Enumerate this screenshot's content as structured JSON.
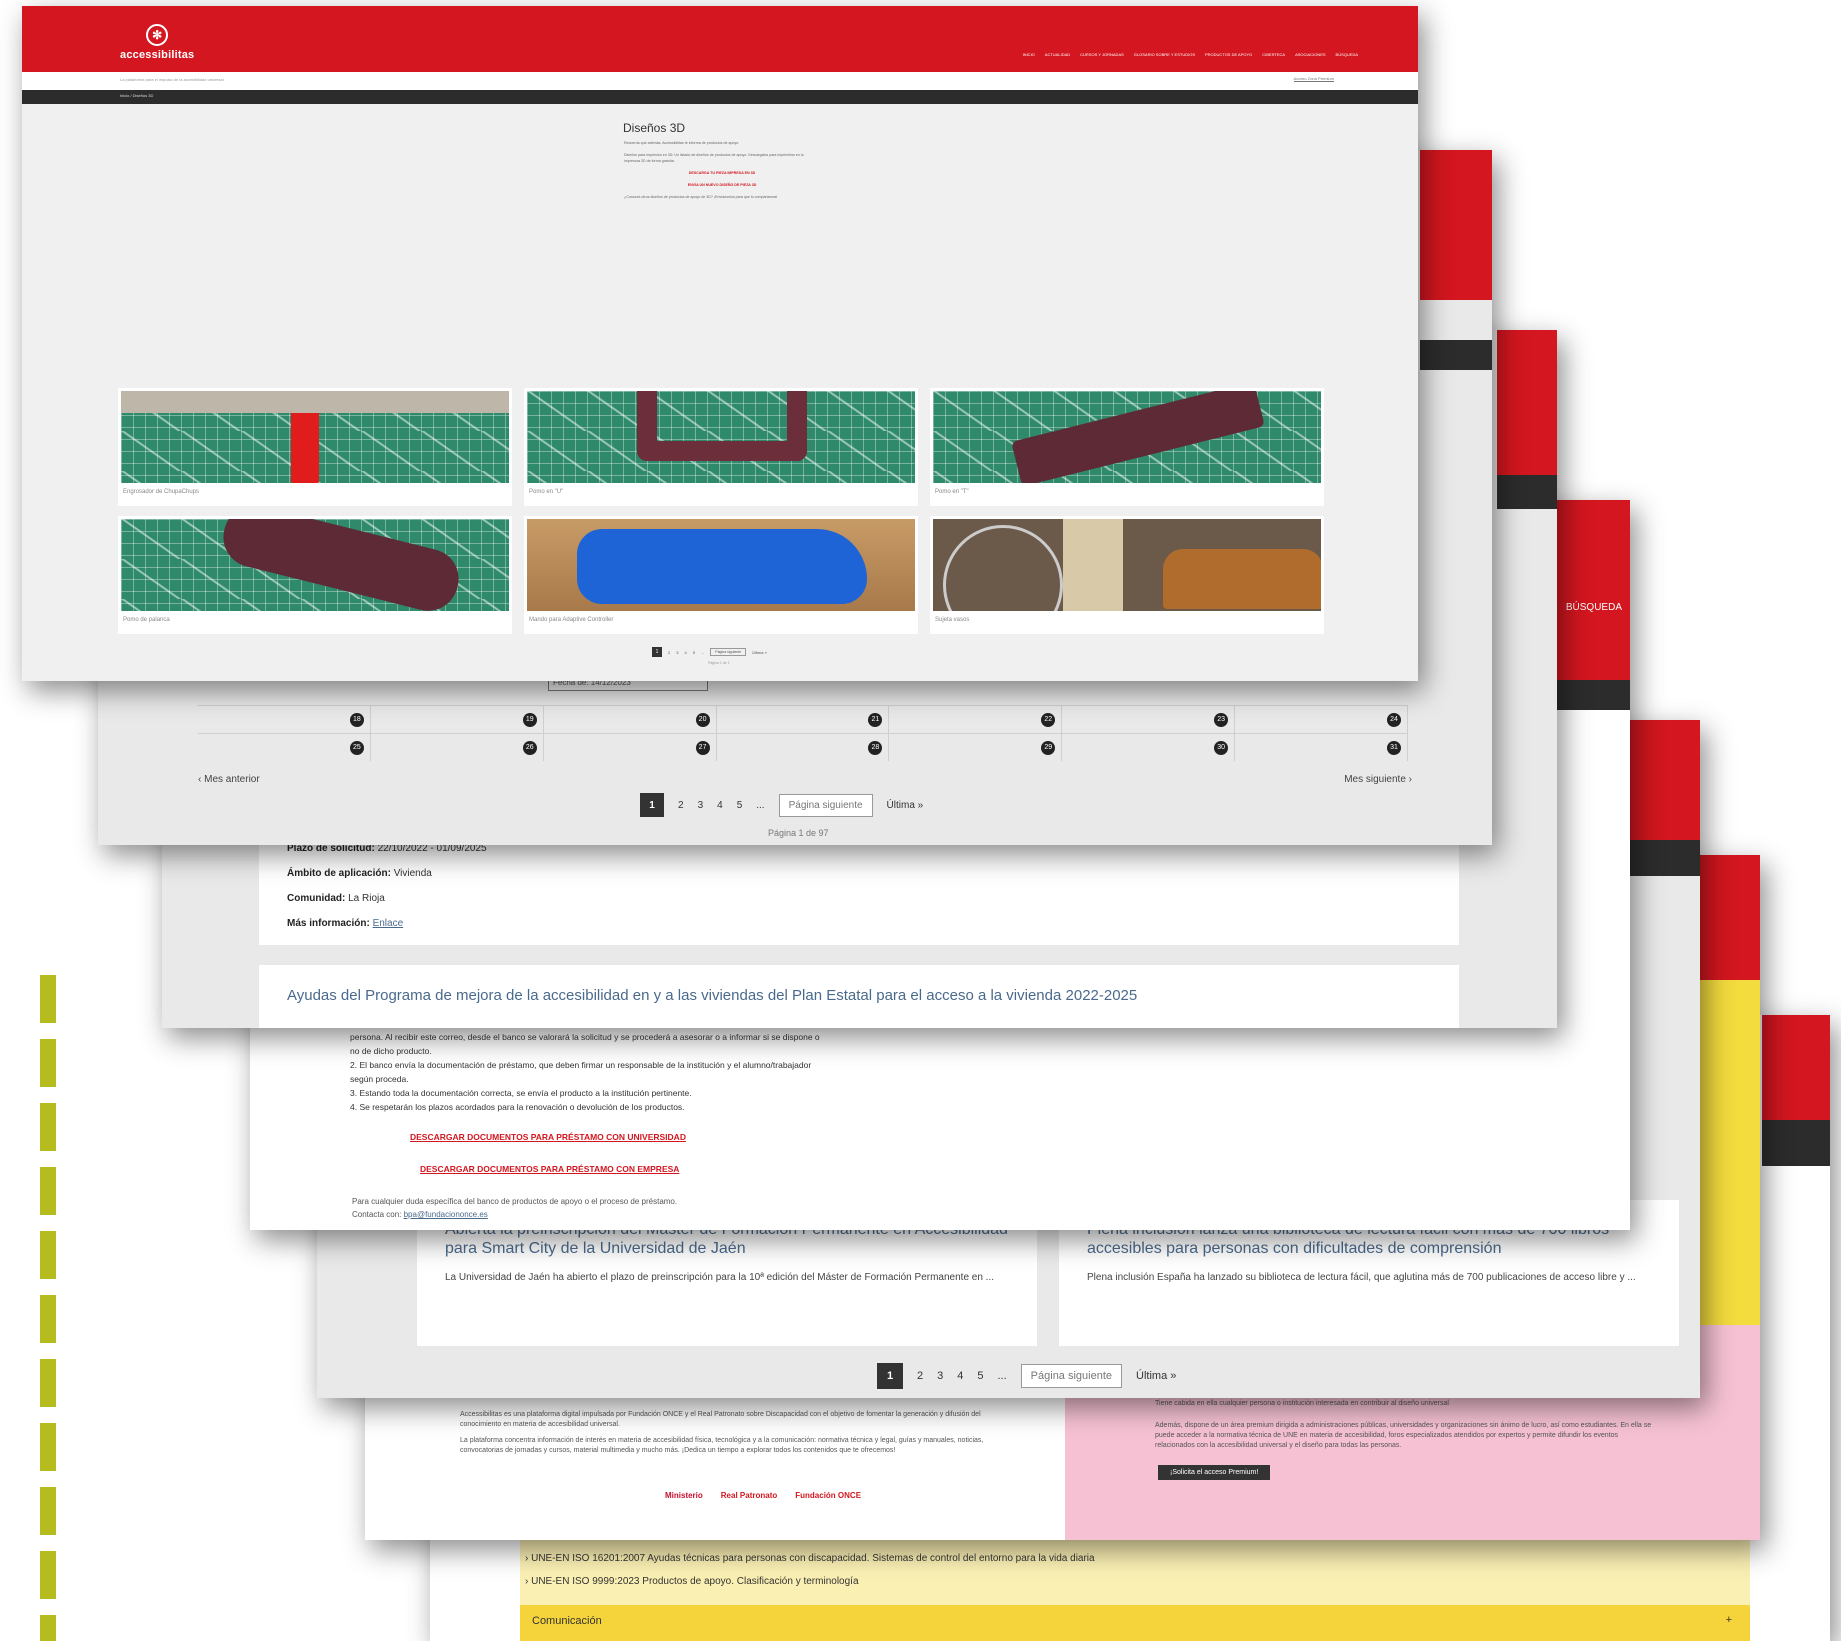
{
  "sheet1": {
    "logo": "accessibilitas",
    "nav": [
      "Inicio",
      "Actualidad",
      "Cursos y jornadas",
      "Glosario sobre y estudios",
      "Productos de apoyo",
      "Ciberteca",
      "Asociaciones",
      "Búsqueda"
    ],
    "subheader_text": "La plataforma para el impulso de la accesibilidad universal",
    "account_link": "Acceso Zona Premium",
    "breadcrumb": "Inicio / Diseños 3D",
    "title": "Diseños 3D",
    "intro_lines": [
      "Recuerda que además, Accessibilitas te informa de productos de apoyo.",
      "Diseños para impresión en 3D: Un listado de diseños de productos de apoyo. Descárgalos para imprimirlos en tu impresora 3D de forma gratuita.",
      "¿Conoces otros diseños de productos de apoyo de 3D? ¡Envíanoslos para que lo compartamos!"
    ],
    "red_link_1": "DESCARGA TU PIEZA IMPRESA EN 3D",
    "red_link_2": "ENVÍA UN NUEVO DISEÑO DE PIEZA 3D",
    "products": [
      {
        "caption": "Engrosador de ChupaChups"
      },
      {
        "caption": "Pomo en \"U\""
      },
      {
        "caption": "Pomo en \"T\""
      },
      {
        "caption": "Pomo de palanca"
      },
      {
        "caption": "Mando para Adaptive Controller"
      },
      {
        "caption": "Sujeta vasos"
      }
    ],
    "pagination": {
      "pages": [
        "1",
        "2",
        "3",
        "4",
        "5",
        "..."
      ],
      "next": "Página siguiente",
      "last": "Última »",
      "info": "Página 1 de 1"
    }
  },
  "sheet2": {
    "date_field": "Fecha de: 14/12/2023",
    "calendar_rows": [
      [
        "18",
        "19",
        "20",
        "21",
        "22",
        "23",
        "24"
      ],
      [
        "25",
        "26",
        "27",
        "28",
        "29",
        "30",
        "31"
      ]
    ],
    "prev_month": "‹ Mes anterior",
    "next_month": "Mes siguiente ›",
    "pagination": {
      "pages": [
        "1",
        "2",
        "3",
        "4",
        "5",
        "..."
      ],
      "next": "Página siguiente",
      "last": "Última »",
      "info": "Página 1 de 97"
    }
  },
  "sheet3": {
    "fields": [
      {
        "label": "Plazo de solicitud:",
        "value": "22/10/2022 - 01/09/2025"
      },
      {
        "label": "Ámbito de aplicación:",
        "value": "Vivienda"
      },
      {
        "label": "Comunidad:",
        "value": "La Rioja"
      },
      {
        "label": "Más información:",
        "value": "Enlace"
      }
    ],
    "card_title": "Ayudas del Programa de mejora de la accesibilidad en y a las viviendas del Plan Estatal para el acceso a la vivienda 2022-2025"
  },
  "sheet4": {
    "search_label": "BÚSQUEDA",
    "step_lead": "persona. Al recibir este correo, desde el banco se valorará la solicitud y se procederá a asesorar o a informar si se dispone o no de dicho producto.",
    "steps": [
      "2. El banco envía la documentación de préstamo, que deben firmar un responsable de la institución y el alumno/trabajador según proceda.",
      "3. Estando toda la documentación correcta, se envía el producto a la institución pertinente.",
      "4. Se respetarán los plazos acordados para la renovación o devolución de los productos."
    ],
    "download_1": "DESCARGAR DOCUMENTOS PARA PRÉSTAMO CON UNIVERSIDAD",
    "download_2": "DESCARGAR DOCUMENTOS PARA PRÉSTAMO CON EMPRESA",
    "contact_line": "Para cualquier duda específica del banco de productos de apoyo o el proceso de préstamo.",
    "contact_label": "Contacta con:",
    "contact_email": "bpa@fundaciononce.es"
  },
  "sheet5": {
    "cards": [
      {
        "title": "Abierta la preinscripción del Máster de Formación Permanente en Accesibilidad para Smart City de la Universidad de Jaén",
        "excerpt": "La Universidad de Jaén ha abierto el plazo de preinscripción para la 10ª edición del Máster de Formación Permanente en ..."
      },
      {
        "title": "Plena inclusión lanza una biblioteca de lectura fácil con más de 700 libros accesibles para personas con dificultades de comprensión",
        "excerpt": "Plena inclusión España ha lanzado su biblioteca de lectura fácil, que aglutina más de 700 publicaciones de acceso libre y ..."
      }
    ],
    "pagination": {
      "pages": [
        "1",
        "2",
        "3",
        "4",
        "5",
        "..."
      ],
      "next": "Página siguiente",
      "last": "Última »"
    }
  },
  "sheet6": {
    "about_1": "Accessibilitas es una plataforma digital impulsada por Fundación ONCE y el Real Patronato sobre Discapacidad con el objetivo de fomentar la generación y difusión del conocimiento en materia de accesibilidad universal.",
    "about_2": "La plataforma concentra información de interés en materia de accesibilidad física, tecnológica y a la comunicación: normativa técnica y legal, guías y manuales, noticias, convocatorias de jornadas y cursos, material multimedia y mucho más. ¡Dedica un tiempo a explorar todos los contenidos que te ofrecemos!",
    "logos": [
      "Ministerio",
      "Real Patronato",
      "Fundación ONCE"
    ],
    "premium_title": "Tiene cabida en ella cualquier persona o institución interesada en contribuir al diseño universal",
    "premium_text": "Además, dispone de un área premium dirigida a administraciones públicas, universidades y organizaciones sin ánimo de lucro, así como estudiantes. En ella se puede acceder a la normativa técnica de UNE en materia de accesibilidad, foros especializados atendidos por expertos y permite difundir los eventos relacionados con la accesibilidad universal y el diseño para todas las personas.",
    "premium_button": "¡Solicita el acceso Premium!"
  },
  "sheet7": {
    "norms": [
      "› UNE-EN ISO 16201:2007 Ayudas técnicas para personas con discapacidad. Sistemas de control del entorno para la vida diaria",
      "› UNE-EN ISO 9999:2023 Productos de apoyo. Clasificación y terminología"
    ],
    "section": "Comunicación",
    "section_toggle": "+"
  },
  "colors": {
    "brand_red": "#d3161f",
    "dark_bar": "#2c2c2c",
    "accent_yellow": "#f5d33a",
    "accent_olive": "#b5bd1e",
    "link_blue": "#4a6a8c"
  }
}
